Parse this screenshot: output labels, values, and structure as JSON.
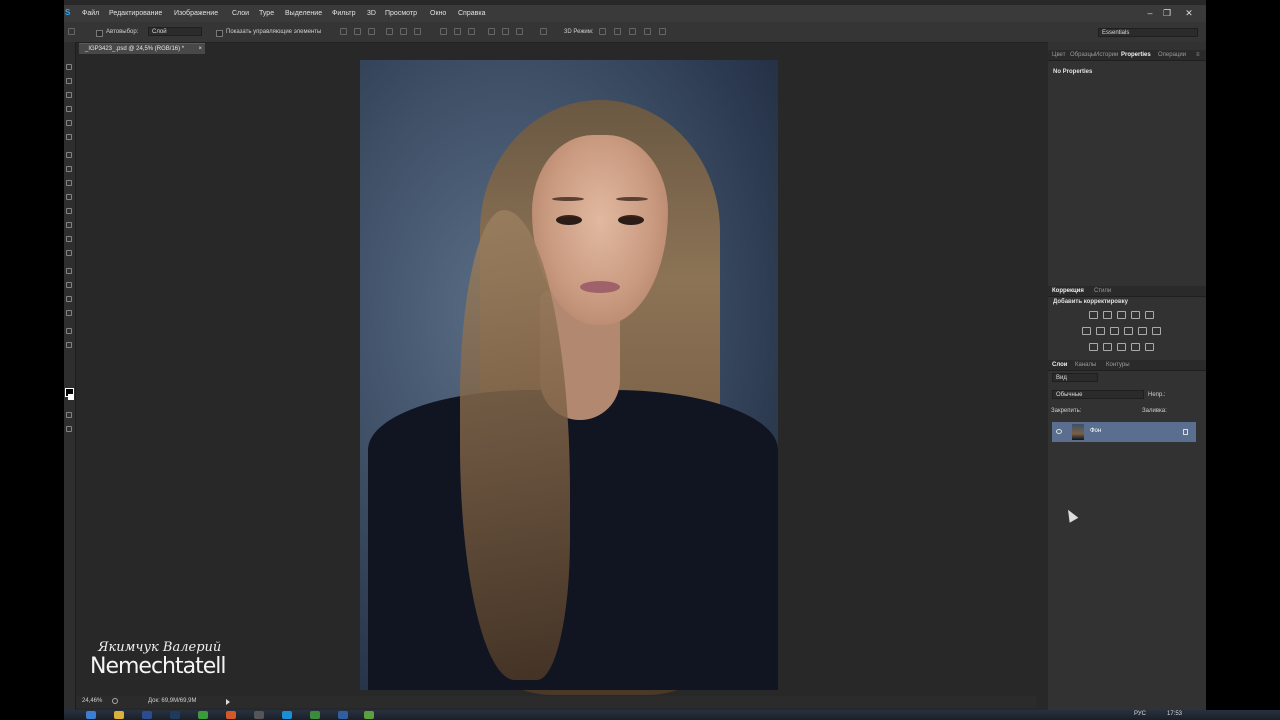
{
  "menu": {
    "logo": "S",
    "items": [
      "Файл",
      "Редактирование",
      "Изображение",
      "Слои",
      "Туре",
      "Выделение",
      "Фильтр",
      "3D",
      "Просмотр",
      "Окно",
      "Справка"
    ]
  },
  "window_controls": {
    "minimize": "–",
    "restore": "❐",
    "close": "✕"
  },
  "options_bar": {
    "auto_select_label": "Автовыбор:",
    "auto_select_value": "Слой",
    "show_transform_label": "Показать управляющие элементы",
    "mode_3d_label": "3D Режим:",
    "workspace": "Essentials"
  },
  "document_tab": {
    "title": "_IGP3423_.psd @ 24,5% (RGB/16) *",
    "close": "×"
  },
  "status_bar": {
    "zoom": "24,46%",
    "doc": "Док: 69,9М/69,9М"
  },
  "signature": {
    "script": "Якимчук Валерий",
    "brand": "Nemechtatell"
  },
  "properties_panel": {
    "tabs": [
      "Цвет",
      "Образцы",
      "Истории",
      "Properties",
      "Операции"
    ],
    "active_tab": "Properties",
    "content": "No Properties"
  },
  "adjustments_panel": {
    "tabs": [
      "Коррекция",
      "Стили"
    ],
    "title": "Добавить корректировку"
  },
  "layers_panel": {
    "tabs": [
      "Слои",
      "Каналы",
      "Контуры"
    ],
    "filter": "Вид",
    "blend_mode": "Обычные",
    "opacity_label": "Непр.:",
    "lock_label": "Закрепить:",
    "fill_label": "Заливка:",
    "layers": [
      {
        "name": "Фон",
        "locked": true,
        "visible": true
      }
    ]
  },
  "taskbar": {
    "lang": "РУС",
    "time": "17:53"
  },
  "colors": {
    "accent": "#31a8ff",
    "layer_selected": "#5a6f8f",
    "panel_bg": "#323232"
  }
}
